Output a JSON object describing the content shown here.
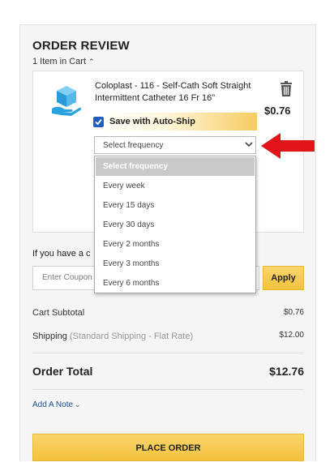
{
  "review": {
    "title": "ORDER REVIEW",
    "items_label": "1 Item in Cart",
    "toggle_glyph": "⌃"
  },
  "product": {
    "name": "Coloplast - 116 - Self-Cath Soft Straight Intermittent Catheter 16 Fr 16\"",
    "price": "$0.76",
    "autoship_label": "Save with Auto-Ship",
    "autoship_checked": true,
    "frequency_value": "Select frequency",
    "frequency_options": [
      "Select frequency",
      "Every week",
      "Every 15 days",
      "Every 30 days",
      "Every 2 months",
      "Every 3 months",
      "Every 6 months"
    ],
    "icon": "box-hand-icon"
  },
  "coupon": {
    "label": "If you have a c",
    "placeholder": "Enter Coupon",
    "apply_label": "Apply"
  },
  "summary": {
    "subtotal_label": "Cart Subtotal",
    "subtotal_value": "$0.76",
    "shipping_label": "Shipping",
    "shipping_method": "(Standard Shipping - Flat Rate)",
    "shipping_value": "$12.00",
    "total_label": "Order Total",
    "total_value": "$12.76"
  },
  "note": {
    "label": "Add A Note",
    "glyph": "⌄"
  },
  "place_order_label": "PLACE ORDER",
  "colors": {
    "accent_yellow": "#f3c23c",
    "checkbox_blue": "#1f5fbf",
    "arrow_red": "#e3131b",
    "link_blue": "#1f4f8f"
  }
}
